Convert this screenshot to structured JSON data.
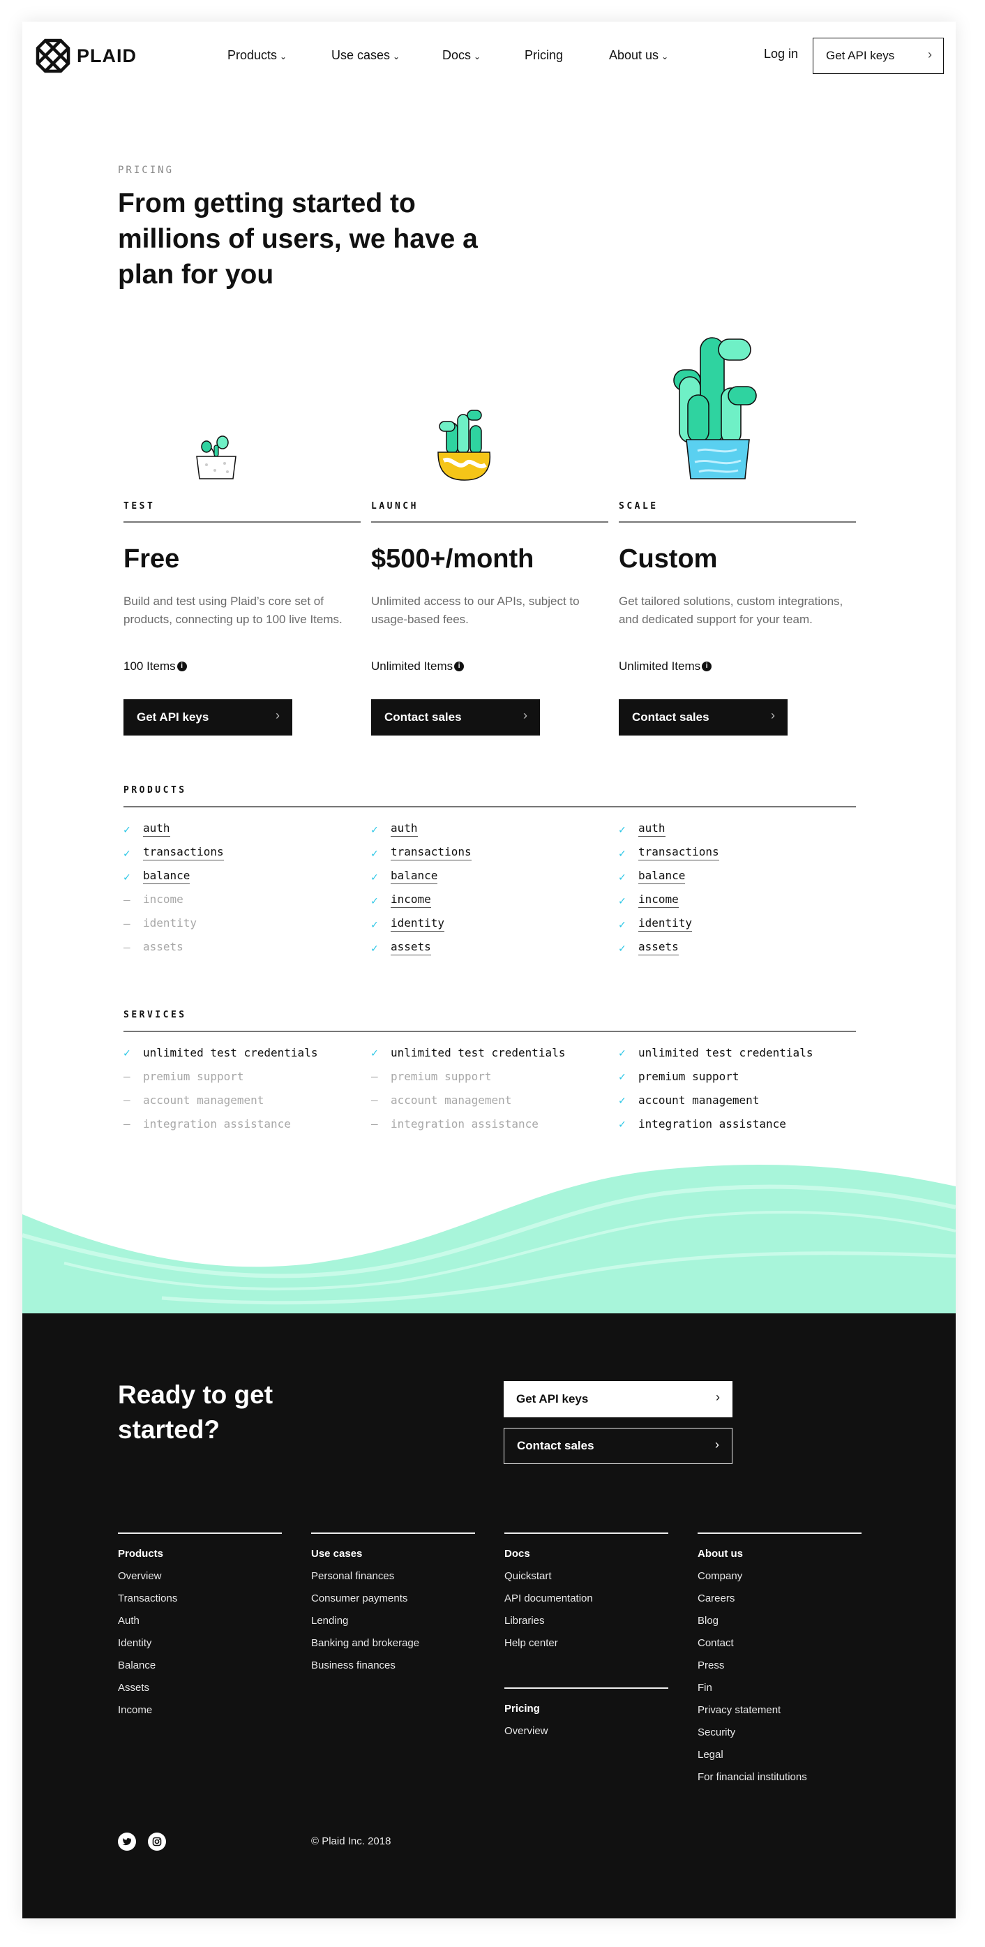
{
  "nav": {
    "brand": "PLAID",
    "items": [
      {
        "label": "Products",
        "dropdown": true
      },
      {
        "label": "Use cases",
        "dropdown": true
      },
      {
        "label": "Docs",
        "dropdown": true
      },
      {
        "label": "Pricing",
        "dropdown": false
      },
      {
        "label": "About us",
        "dropdown": true
      }
    ],
    "login": "Log in",
    "cta": "Get API keys"
  },
  "hero": {
    "eyebrow": "PRICING",
    "title": "From getting started to millions of users, we have a plan for you"
  },
  "plans": [
    {
      "label": "TEST",
      "price": "Free",
      "description": "Build and test using Plaid’s core set of products, connecting up to 100 live Items.",
      "items": "100 Items",
      "button": "Get API keys"
    },
    {
      "label": "LAUNCH",
      "price": "$500+/month",
      "description": "Unlimited access to our APIs, subject to usage-based fees.",
      "items": "Unlimited Items",
      "button": "Contact sales"
    },
    {
      "label": "SCALE",
      "price": "Custom",
      "description": "Get tailored solutions, custom integrations, and dedicated support for your team.",
      "items": "Unlimited Items",
      "button": "Contact sales"
    }
  ],
  "products": {
    "label": "PRODUCTS",
    "columns": [
      [
        {
          "name": "auth",
          "included": true
        },
        {
          "name": "transactions",
          "included": true
        },
        {
          "name": "balance",
          "included": true
        },
        {
          "name": "income",
          "included": false
        },
        {
          "name": "identity",
          "included": false
        },
        {
          "name": "assets",
          "included": false
        }
      ],
      [
        {
          "name": "auth",
          "included": true
        },
        {
          "name": "transactions",
          "included": true
        },
        {
          "name": "balance",
          "included": true
        },
        {
          "name": "income",
          "included": true
        },
        {
          "name": "identity",
          "included": true
        },
        {
          "name": "assets",
          "included": true
        }
      ],
      [
        {
          "name": "auth",
          "included": true
        },
        {
          "name": "transactions",
          "included": true
        },
        {
          "name": "balance",
          "included": true
        },
        {
          "name": "income",
          "included": true
        },
        {
          "name": "identity",
          "included": true
        },
        {
          "name": "assets",
          "included": true
        }
      ]
    ]
  },
  "services": {
    "label": "SERVICES",
    "columns": [
      [
        {
          "name": "unlimited test credentials",
          "included": true
        },
        {
          "name": "premium support",
          "included": false
        },
        {
          "name": "account management",
          "included": false
        },
        {
          "name": "integration assistance",
          "included": false
        }
      ],
      [
        {
          "name": "unlimited test credentials",
          "included": true
        },
        {
          "name": "premium support",
          "included": false
        },
        {
          "name": "account management",
          "included": false
        },
        {
          "name": "integration assistance",
          "included": false
        }
      ],
      [
        {
          "name": "unlimited test credentials",
          "included": true
        },
        {
          "name": "premium support",
          "included": true
        },
        {
          "name": "account management",
          "included": true
        },
        {
          "name": "integration assistance",
          "included": true
        }
      ]
    ]
  },
  "marks": {
    "included": "✓",
    "excluded": "–"
  },
  "cta": {
    "title": "Ready to get started?",
    "primary": "Get API keys",
    "secondary": "Contact sales"
  },
  "footer": {
    "columns": [
      {
        "heading": "Products",
        "links": [
          "Overview",
          "Transactions",
          "Auth",
          "Identity",
          "Balance",
          "Assets",
          "Income"
        ]
      },
      {
        "heading": "Use cases",
        "links": [
          "Personal finances",
          "Consumer payments",
          "Lending",
          "Banking and brokerage",
          "Business finances"
        ]
      },
      {
        "heading": "Docs",
        "links": [
          "Quickstart",
          "API documentation",
          "Libraries",
          "Help center"
        ]
      },
      {
        "heading": "About us",
        "links": [
          "Company",
          "Careers",
          "Blog",
          "Contact",
          "Press",
          "Fin",
          "Privacy statement",
          "Security",
          "Legal",
          "For financial institutions"
        ]
      }
    ],
    "extra": {
      "heading": "Pricing",
      "links": [
        "Overview"
      ]
    },
    "social": [
      "twitter-icon",
      "instagram-icon"
    ],
    "copyright": "© Plaid Inc. 2018"
  },
  "colors": {
    "accent": "#29c6e6",
    "mint": "#a8f5da",
    "plant_green": "#2fd3a0",
    "pot_yellow": "#f5c518",
    "pot_blue": "#5ad0f0",
    "dark": "#111111"
  }
}
